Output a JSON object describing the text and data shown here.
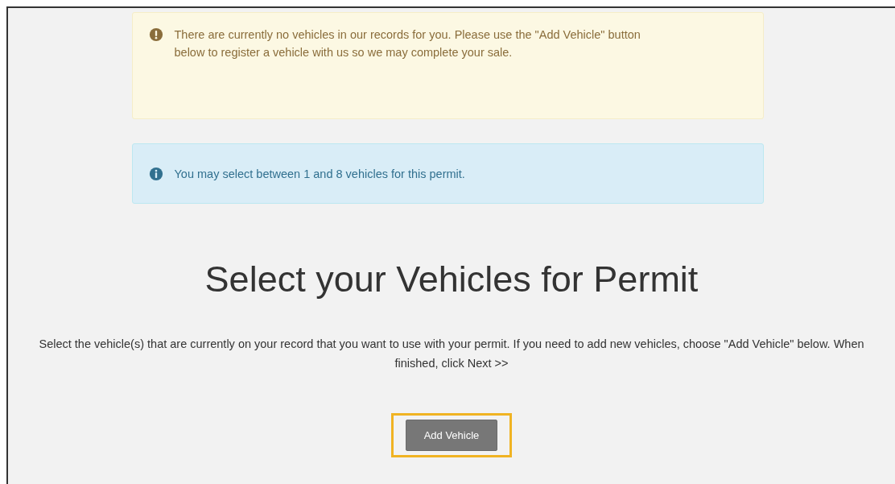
{
  "alerts": [
    {
      "kind": "warning",
      "text": "There are currently no vehicles in our records for you. Please use the \"Add Vehicle\" button below to register a vehicle with us so we may complete your sale."
    },
    {
      "kind": "info",
      "text": "You may select between 1 and 8 vehicles for this permit."
    }
  ],
  "heading": "Select your Vehicles for Permit",
  "instructions": "Select the vehicle(s) that are currently on your record that you want to use with your permit. If you need to add new vehicles, choose \"Add Vehicle\" below. When finished, click Next >>",
  "button": {
    "label": "Add Vehicle",
    "highlighted": true
  }
}
